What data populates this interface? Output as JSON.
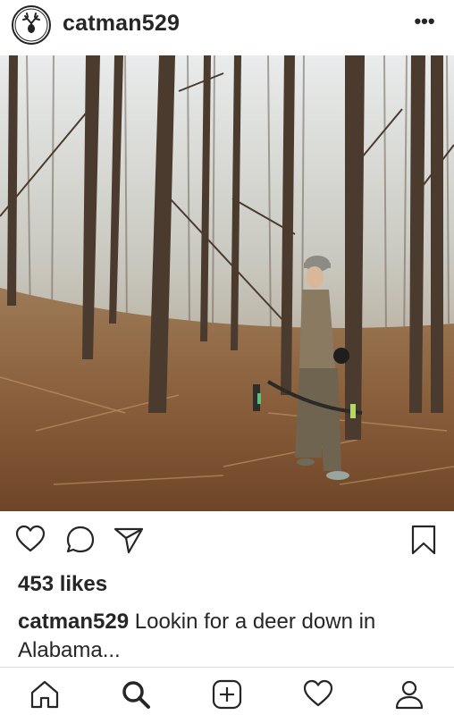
{
  "post": {
    "username": "catman529",
    "more_label": "•••",
    "avatar_icon": "antler-logo-icon",
    "likes_text": "453 likes",
    "caption_user": "catman529",
    "caption_text": "Lookin for a deer down in Alabama..."
  },
  "actions": {
    "like_icon": "heart-icon",
    "comment_icon": "comment-icon",
    "share_icon": "send-icon",
    "save_icon": "bookmark-icon"
  },
  "tabbar": {
    "items": [
      "home-icon",
      "search-icon",
      "add-icon",
      "activity-heart-icon",
      "profile-icon"
    ]
  },
  "colors": {
    "text": "#262626",
    "divider": "#dbdbdb"
  }
}
